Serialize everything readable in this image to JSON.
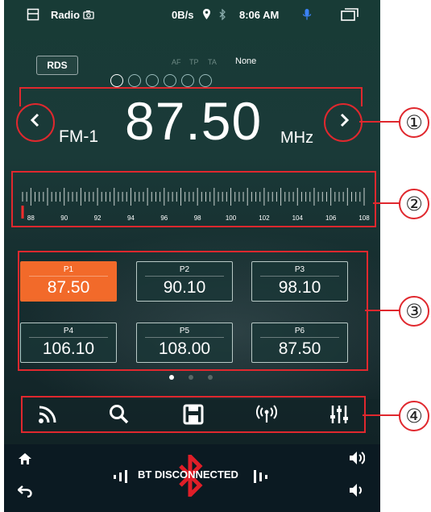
{
  "status_bar": {
    "app_title": "Radio",
    "net_speed": "0B/s",
    "time": "8:06 AM"
  },
  "rds": {
    "button_label": "RDS",
    "flags": [
      "AF",
      "TP",
      "TA"
    ],
    "value": "None"
  },
  "tuner": {
    "band": "FM-1",
    "frequency": "87.50",
    "unit": "MHz",
    "prev_icon": "chevron-left-icon",
    "next_icon": "chevron-right-icon"
  },
  "scale": {
    "ticks": [
      "88",
      "90",
      "92",
      "94",
      "96",
      "98",
      "100",
      "102",
      "104",
      "106",
      "108"
    ],
    "min": 87.5,
    "max": 108.0,
    "current": 87.5
  },
  "presets": [
    {
      "name": "P1",
      "freq": "87.50",
      "active": true
    },
    {
      "name": "P2",
      "freq": "90.10",
      "active": false
    },
    {
      "name": "P3",
      "freq": "98.10",
      "active": false
    },
    {
      "name": "P4",
      "freq": "106.10",
      "active": false
    },
    {
      "name": "P5",
      "freq": "108.00",
      "active": false
    },
    {
      "name": "P6",
      "freq": "87.50",
      "active": false
    }
  ],
  "pagination": {
    "pages": 3,
    "current": 1
  },
  "toolbar": {
    "icons": [
      "signal-icon",
      "search-icon",
      "save-icon",
      "antenna-icon",
      "equalizer-icon"
    ]
  },
  "bottom_bar": {
    "bt_status": "BT DISCONNECTED",
    "icons": [
      "home-icon",
      "back-icon",
      "bluetooth-icon",
      "volume-up-icon",
      "volume-down-icon"
    ]
  },
  "callouts": [
    "①",
    "②",
    "③",
    "④"
  ],
  "colors": {
    "accent": "#f26a2a",
    "annotation_red": "#e0282e",
    "bluetooth_red": "#e01e28"
  }
}
